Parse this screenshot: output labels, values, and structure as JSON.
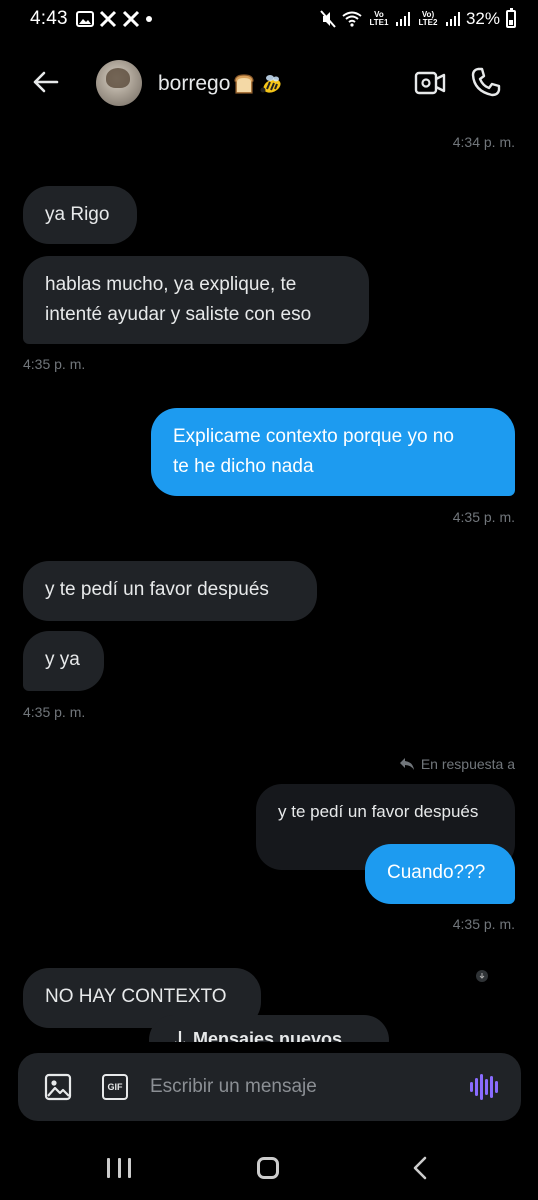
{
  "status_bar": {
    "time": "4:43",
    "left_icons": [
      "image-icon",
      "x-logo-icon",
      "x-logo-icon",
      "dot-icon"
    ],
    "lte1_label": "Vo LTE1",
    "lte2_label": "Vo) LTE2",
    "battery": "32%"
  },
  "header": {
    "contact_name": "borrego",
    "name_emojis": [
      "bread-emoji",
      "bee-emoji"
    ]
  },
  "messages": {
    "ts1": "4:34 p. m.",
    "m1": "ya Rigo",
    "m2_line1": "hablas mucho, ya explique, te",
    "m2_line2": "intenté ayudar y saliste con eso",
    "ts2": "4:35 p. m.",
    "m3_line1": "Explicame contexto porque yo no",
    "m3_line2": "te he dicho nada",
    "ts3": "4:35 p. m.",
    "m4": "y te pedí un favor después",
    "m5": "y ya",
    "ts4": "4:35 p. m.",
    "reply_label": "En respuesta a",
    "quoted_text": "y te pedí un favor después",
    "m6": "Cuando???",
    "ts5": "4:35 p. m.",
    "m7": "NO HAY CONTEXTO"
  },
  "new_messages_pill": "Mensajes nuevos",
  "composer": {
    "gif_label": "GIF",
    "placeholder": "Escribir un mensaje"
  },
  "colors": {
    "background": "#000000",
    "incoming_bubble": "#202327",
    "outgoing_bubble": "#1d9bf0",
    "timestamp": "#71767b",
    "voice_accent": "#8a6cff"
  }
}
